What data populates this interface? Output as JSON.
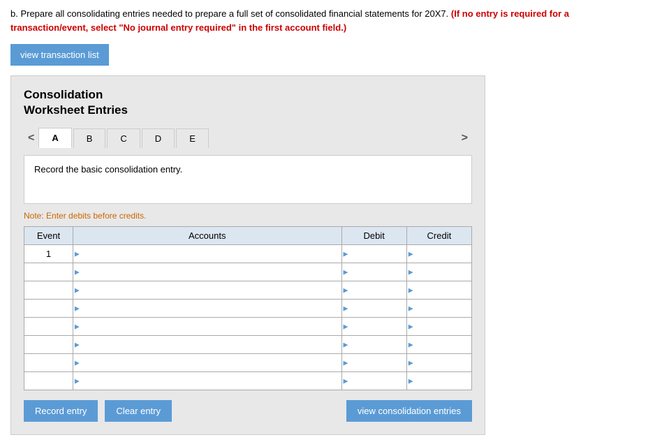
{
  "instructions": {
    "text1": "b. Prepare all consolidating entries needed to prepare a full set of consolidated financial statements for 20X7.",
    "text2": "(If no entry is required for a transaction/event, select \"No journal entry required\" in the first account field.)"
  },
  "buttons": {
    "view_transaction_list": "view transaction list",
    "record_entry": "Record entry",
    "clear_entry": "Clear entry",
    "view_consolidation_entries": "view consolidation entries"
  },
  "worksheet": {
    "title_line1": "Consolidation",
    "title_line2": "Worksheet Entries",
    "tabs": [
      {
        "label": "A",
        "active": true
      },
      {
        "label": "B",
        "active": false
      },
      {
        "label": "C",
        "active": false
      },
      {
        "label": "D",
        "active": false
      },
      {
        "label": "E",
        "active": false
      }
    ],
    "entry_description": "Record the basic consolidation entry.",
    "note": "Note: Enter debits before credits.",
    "table": {
      "headers": {
        "event": "Event",
        "accounts": "Accounts",
        "debit": "Debit",
        "credit": "Credit"
      },
      "rows": [
        {
          "event": "1",
          "account": "",
          "debit": "",
          "credit": ""
        },
        {
          "event": "",
          "account": "",
          "debit": "",
          "credit": ""
        },
        {
          "event": "",
          "account": "",
          "debit": "",
          "credit": ""
        },
        {
          "event": "",
          "account": "",
          "debit": "",
          "credit": ""
        },
        {
          "event": "",
          "account": "",
          "debit": "",
          "credit": ""
        },
        {
          "event": "",
          "account": "",
          "debit": "",
          "credit": ""
        },
        {
          "event": "",
          "account": "",
          "debit": "",
          "credit": ""
        },
        {
          "event": "",
          "account": "",
          "debit": "",
          "credit": ""
        }
      ]
    }
  }
}
